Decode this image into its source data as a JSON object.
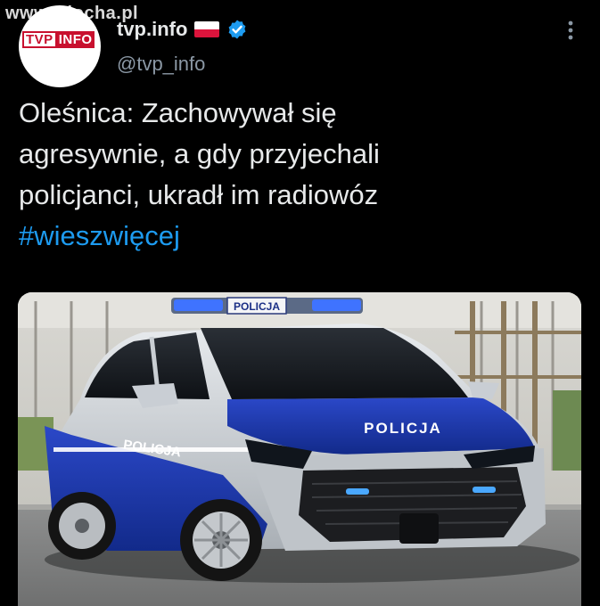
{
  "watermark": "www.wiocha.pl",
  "account": {
    "display_name": "tvp.info",
    "handle": "@tvp_info",
    "avatar_logo_left": "TVP",
    "avatar_logo_right": "INFO",
    "verified": true,
    "flag_icon": "poland-flag-icon"
  },
  "tweet": {
    "text_lines": [
      "Oleśnica: Zachowywał się",
      "agresywnie, a gdy przyjechali",
      "policjanci, ukradł im radiowóz"
    ],
    "hashtag": "#wieszwięcej"
  },
  "media": {
    "roof_sign": "POLICJA",
    "hood_text": "POLICJA",
    "door_text": "POLICJA"
  },
  "colors": {
    "background": "#000000",
    "text": "#e7e9ea",
    "secondary": "#8b98a5",
    "link": "#1d9bf0",
    "tvp_red": "#c8102e"
  }
}
